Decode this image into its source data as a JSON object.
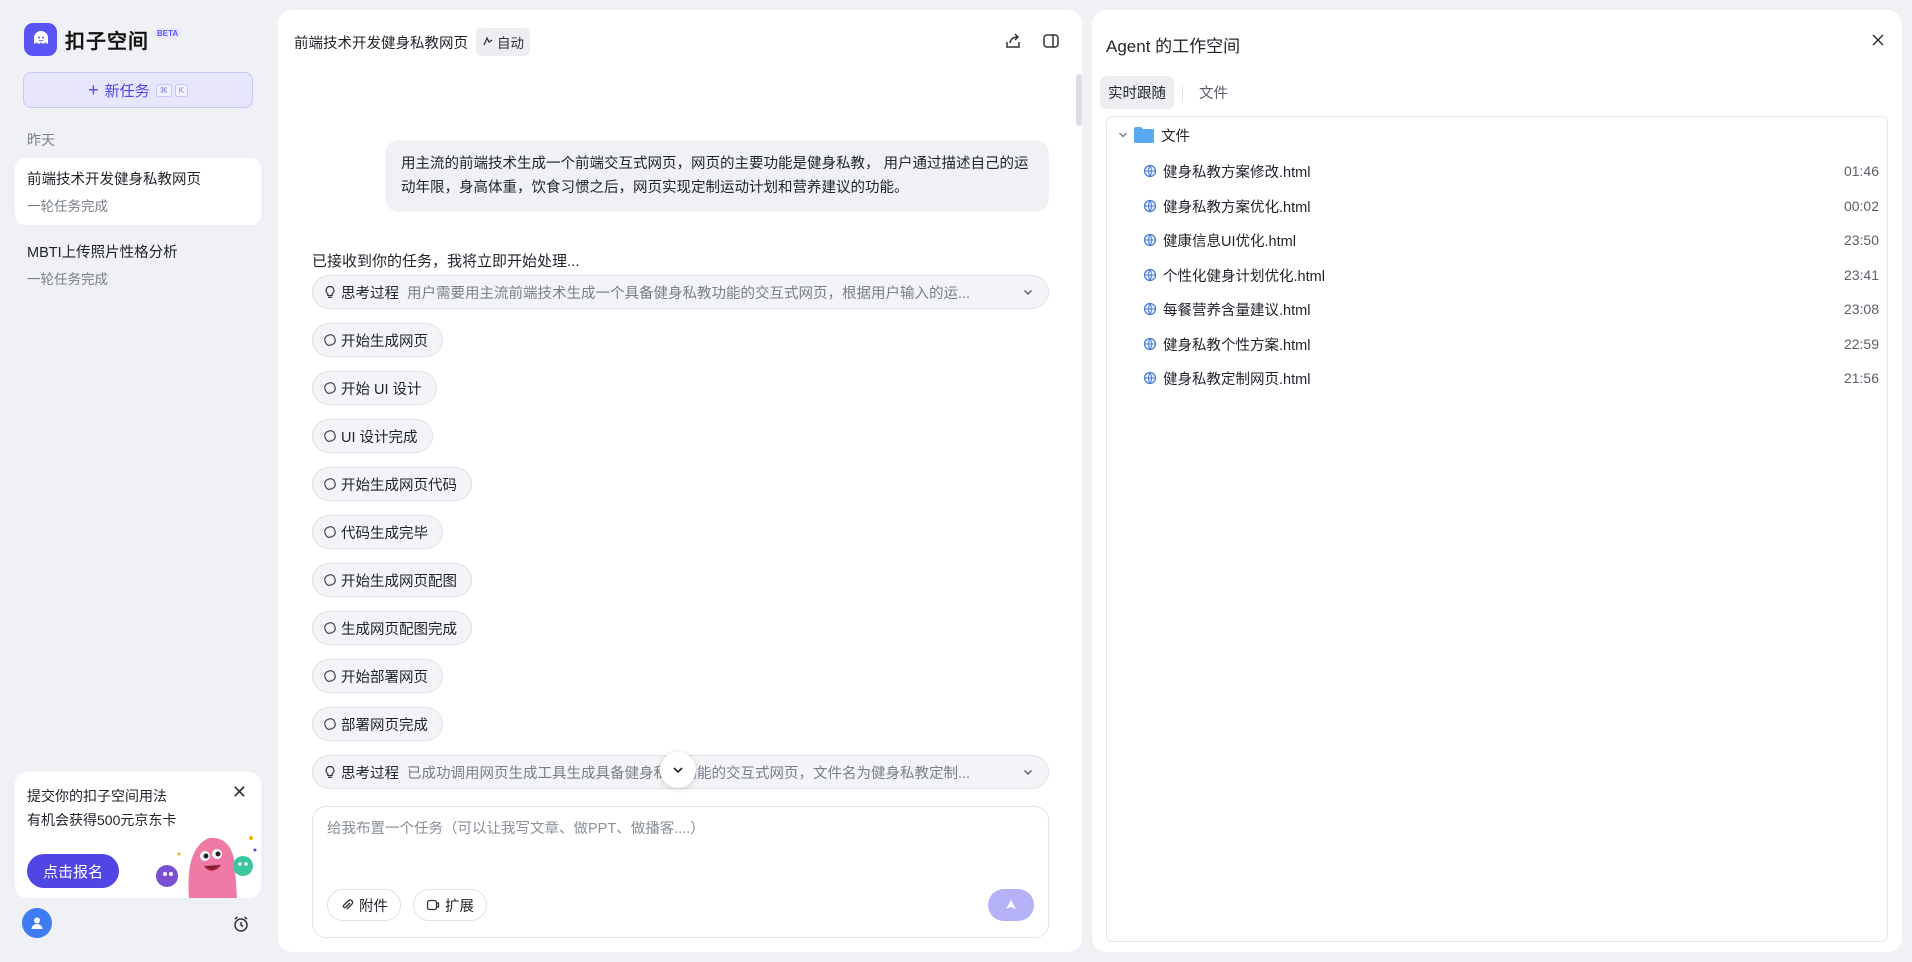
{
  "brand": {
    "name": "扣子空间",
    "badge": "BETA"
  },
  "sidebar": {
    "new_task_label": "新任务",
    "kbd_1": "⌘",
    "kbd_2": "K",
    "group_label": "昨天",
    "history": [
      {
        "title": "前端技术开发健身私教网页",
        "subtitle": "一轮任务完成"
      },
      {
        "title": "MBTI上传照片性格分析",
        "subtitle": "一轮任务完成"
      }
    ],
    "promo": {
      "line1": "提交你的扣子空间用法",
      "line2": "有机会获得500元京东卡",
      "button": "点击报名",
      "close": "✕"
    }
  },
  "chat": {
    "title": "前端技术开发健身私教网页",
    "mode_tag": "自动",
    "user_message": "用主流的前端技术生成一个前端交互式网页，网页的主要功能是健身私教， 用户通过描述自己的运动年限，身高体重，饮食习惯之后，网页实现定制运动计划和营养建议的功能。",
    "ack": "已接收到你的任务，我将立即开始处理...",
    "think1": {
      "label": "思考过程",
      "text": "用户需要用主流前端技术生成一个具备健身私教功能的交互式网页，根据用户输入的运..."
    },
    "steps": [
      "开始生成网页",
      "开始 UI 设计",
      "UI 设计完成",
      "开始生成网页代码",
      "代码生成完毕",
      "开始生成网页配图",
      "生成网页配图完成",
      "开始部署网页",
      "部署网页完成"
    ],
    "think2": {
      "label": "思考过程",
      "text": "已成功调用网页生成工具生成具备健身私教功能的交互式网页，文件名为健身私教定制..."
    },
    "composer": {
      "placeholder": "给我布置一个任务（可以让我写文章、做PPT、做播客....）",
      "attach": "附件",
      "extend": "扩展"
    }
  },
  "workspace": {
    "title": "Agent 的工作空间",
    "tabs": [
      "实时跟随",
      "文件"
    ],
    "folder": "文件",
    "files": [
      {
        "name": "健身私教方案修改.html",
        "time": "01:46"
      },
      {
        "name": "健身私教方案优化.html",
        "time": "00:02"
      },
      {
        "name": "健康信息UI优化.html",
        "time": "23:50"
      },
      {
        "name": "个性化健身计划优化.html",
        "time": "23:41"
      },
      {
        "name": "每餐营养含量建议.html",
        "time": "23:08"
      },
      {
        "name": "健身私教个性方案.html",
        "time": "22:59"
      },
      {
        "name": "健身私教定制网页.html",
        "time": "21:56"
      }
    ]
  },
  "colors": {
    "accent": "#4f46e5",
    "accent_light": "#e7e6fd",
    "bg": "#f0f1f5"
  }
}
